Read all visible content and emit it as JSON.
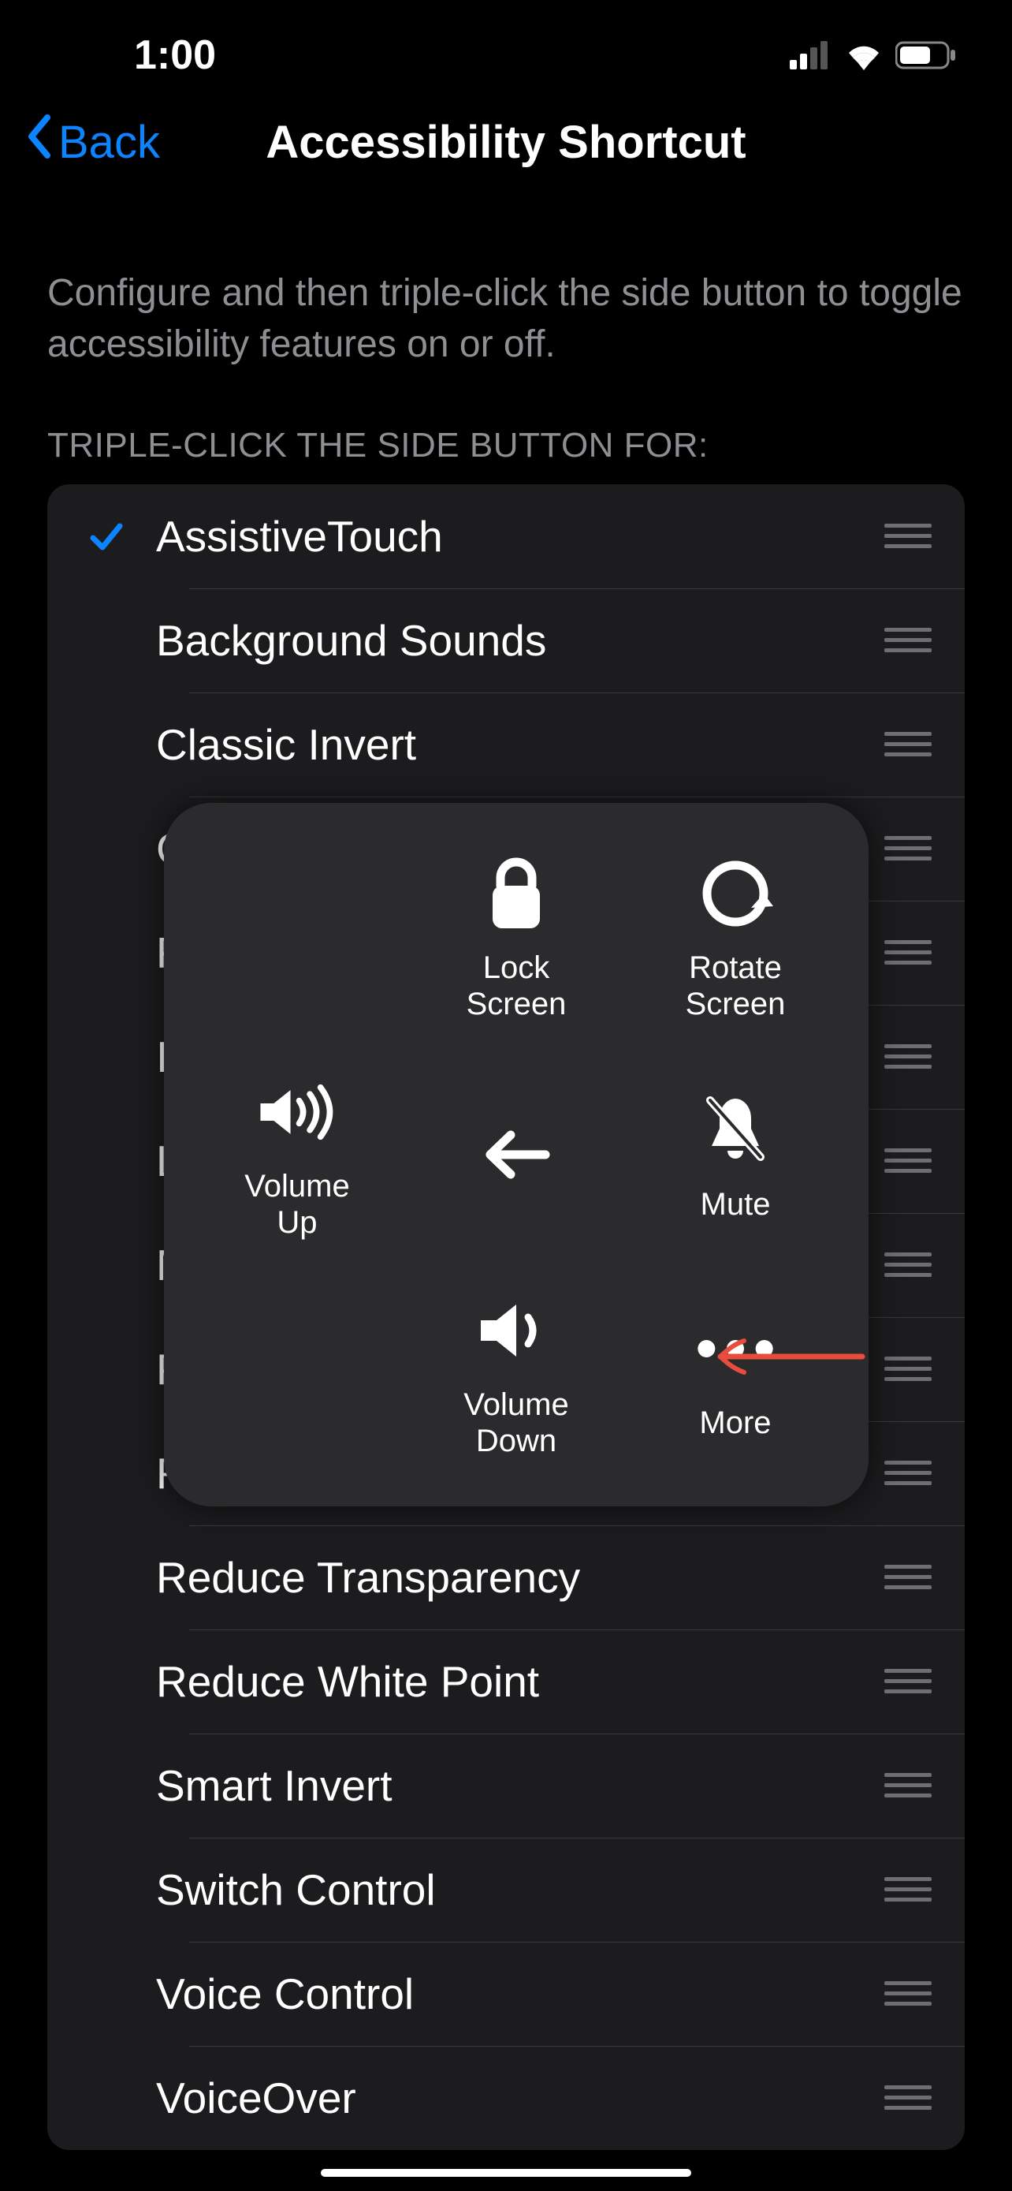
{
  "status": {
    "time": "1:00"
  },
  "nav": {
    "back": "Back",
    "title": "Accessibility Shortcut"
  },
  "desc": "Configure and then triple-click the side button to toggle accessibility features on or off.",
  "section_header": "TRIPLE-CLICK THE SIDE BUTTON FOR:",
  "rows": [
    {
      "label": "AssistiveTouch",
      "checked": true
    },
    {
      "label": "Background Sounds",
      "checked": false
    },
    {
      "label": "Classic Invert",
      "checked": false
    },
    {
      "label": "Color Filters",
      "checked": false
    },
    {
      "label": "Full Keyboard Access",
      "checked": false
    },
    {
      "label": "Increase Contrast",
      "checked": false
    },
    {
      "label": "Left/Right Balance",
      "checked": false
    },
    {
      "label": "Magnifier",
      "checked": false
    },
    {
      "label": "People Detection",
      "checked": false
    },
    {
      "label": "Reduce Motion",
      "checked": false
    },
    {
      "label": "Reduce Transparency",
      "checked": false
    },
    {
      "label": "Reduce White Point",
      "checked": false
    },
    {
      "label": "Smart Invert",
      "checked": false
    },
    {
      "label": "Switch Control",
      "checked": false
    },
    {
      "label": "Voice Control",
      "checked": false
    },
    {
      "label": "VoiceOver",
      "checked": false
    }
  ],
  "assistive_touch": {
    "lock_screen": "Lock\nScreen",
    "rotate_screen": "Rotate\nScreen",
    "volume_up": "Volume\nUp",
    "mute": "Mute",
    "volume_down": "Volume\nDown",
    "more": "More"
  }
}
